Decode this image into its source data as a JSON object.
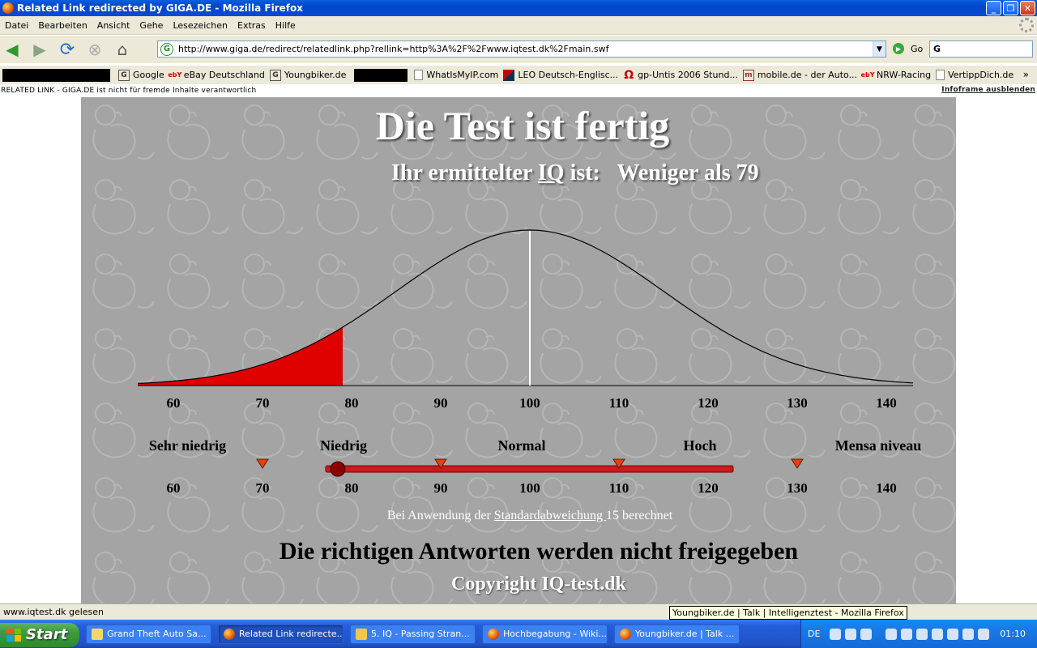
{
  "window": {
    "title": "Related Link redirected by GIGA.DE - Mozilla Firefox"
  },
  "menu": [
    "Datei",
    "Bearbeiten",
    "Ansicht",
    "Gehe",
    "Lesezeichen",
    "Extras",
    "Hilfe"
  ],
  "nav": {
    "url": "http://www.giga.de/redirect/relatedlink.php?rellink=http%3A%2F%2Fwww.iqtest.dk%2Fmain.swf",
    "go_label": "Go",
    "search_value": "G"
  },
  "bookmarks": [
    {
      "label": "Google",
      "icon": "google-icon"
    },
    {
      "label": "eBay Deutschland",
      "icon": "ebay-icon"
    },
    {
      "label": "Youngbiker.de",
      "icon": "google-icon"
    },
    {
      "label": "WhatIsMyIP.com",
      "icon": "page-icon"
    },
    {
      "label": "LEO Deutsch-Englisc...",
      "icon": "leo-icon"
    },
    {
      "label": "gp-Untis 2006 Stund...",
      "icon": "omega-icon"
    },
    {
      "label": "mobile.de - der Auto...",
      "icon": "mobile-icon"
    },
    {
      "label": "NRW-Racing",
      "icon": "ebay-icon"
    },
    {
      "label": "VertippDich.de",
      "icon": "page-icon"
    }
  ],
  "infobar": {
    "left": "RELATED LINK - GIGA.DE ist nicht für fremde Inhalte verantwortlich",
    "right": "Infoframe ausblenden"
  },
  "page": {
    "headline": "Die Test ist fertig",
    "iq_prefix": "Ihr ermittelter ",
    "iq_word": "IQ",
    "iq_suffix": " ist:   Weniger als 79",
    "std_prefix": "Bei Anwendung der ",
    "std_link": "Standardabweichung ",
    "std_suffix": "15 berechnet",
    "answers": "Die richtigen Antworten werden nicht freigegeben",
    "copyright": "Copyright IQ-test.dk"
  },
  "chart_data": [
    {
      "type": "area",
      "distribution": "normal",
      "mean": 100,
      "std": 15,
      "x_ticks": [
        60,
        70,
        80,
        90,
        100,
        110,
        120,
        130,
        140
      ],
      "xlim": [
        56,
        143
      ],
      "highlight_max": 79,
      "highlight_color": "#e00000",
      "mean_line_color": "#ffffff"
    },
    {
      "type": "scale",
      "categories": [
        "Sehr niedrig",
        "Niedrig",
        "Normal",
        "Hoch",
        "Mensa niveau"
      ],
      "boundaries": [
        70,
        90,
        110,
        130
      ],
      "x_ticks": [
        60,
        70,
        80,
        90,
        100,
        110,
        120,
        130,
        140
      ],
      "marker_value": 79,
      "bar_color": "#cc1a1a"
    }
  ],
  "status": {
    "text": "www.iqtest.dk gelesen",
    "tooltip": "Youngbiker.de | Talk | Intelligenztest - Mozilla Firefox"
  },
  "taskbar": {
    "start": "Start",
    "tasks": [
      {
        "label": "Grand Theft Auto Sa...",
        "icon": "folder-icon",
        "active": false
      },
      {
        "label": "Related Link redirecte...",
        "icon": "firefox-icon",
        "active": true
      },
      {
        "label": "5. IQ - Passing Stran...",
        "icon": "winamp-icon",
        "active": false
      },
      {
        "label": "Hochbegabung - Wiki...",
        "icon": "firefox-icon",
        "active": false
      },
      {
        "label": "Youngbiker.de | Talk ...",
        "icon": "firefox-icon",
        "active": false
      }
    ],
    "lang": "DE",
    "clock": "01:10"
  }
}
